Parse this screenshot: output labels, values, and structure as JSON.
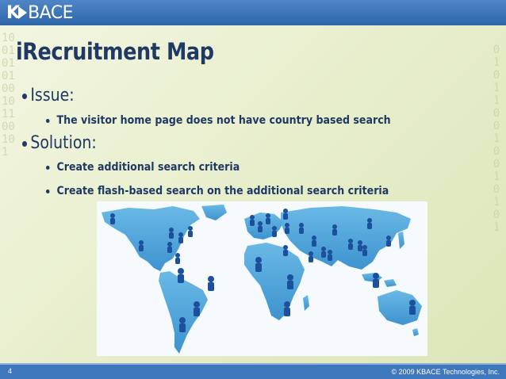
{
  "brand": {
    "logo_k": "K",
    "logo_rest": "BACE"
  },
  "decor": {
    "left_digits": "1 0 0 1 0 1 0 1 0 0 1 0 1 1 0 0 1 0 1",
    "right_digits": "0 1 0 1 1 0 0 1 0 0 1 0 1 0 1"
  },
  "slide": {
    "title": "iRecruitment Map",
    "items": [
      {
        "label": "Issue:",
        "subitems": [
          "The visitor home page does not have country based search"
        ]
      },
      {
        "label": "Solution:",
        "subitems": [
          "Create additional search criteria",
          "Create flash-based search on the additional search criteria"
        ]
      }
    ],
    "image": {
      "icon": "world-map-people-icon"
    }
  },
  "footer": {
    "page_number": "4",
    "copyright": "© 2009 KBACE Technologies, Inc."
  },
  "colors": {
    "header": "#3f77bd",
    "title": "#1f3864",
    "background": "#eef2d6",
    "map_land": "#5aaee0",
    "map_people": "#1c4f9c"
  }
}
